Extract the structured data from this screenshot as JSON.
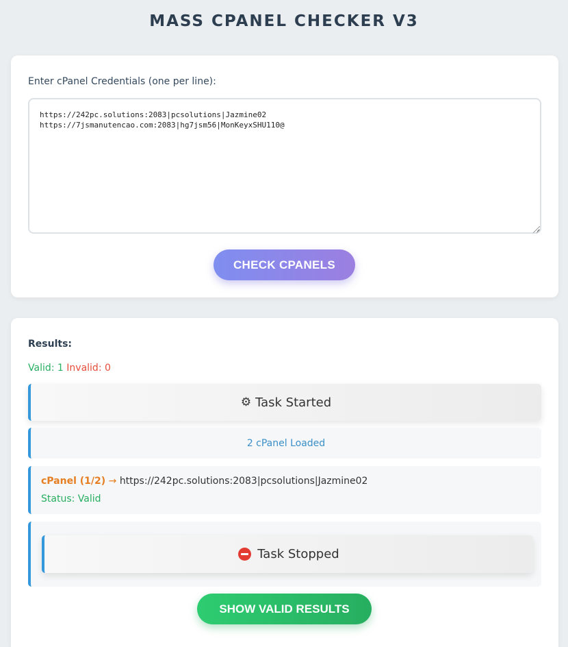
{
  "page": {
    "title": "MASS CPANEL CHECKER V3"
  },
  "input": {
    "label": "Enter cPanel Credentials (one per line):",
    "value": "https://242pc.solutions:2083|pcsolutions|Jazmine02\nhttps://7jsmanutencao.com:2083|hg7jsm56|MonKeyxSHU110@",
    "check_button": "CHECK CPANELS"
  },
  "results": {
    "label": "Results:",
    "valid_label": "Valid:",
    "valid_count": "1",
    "invalid_label": "Invalid:",
    "invalid_count": "0",
    "task_started": "Task Started",
    "loaded": "2 cPanel Loaded",
    "entry": {
      "tag": "cPanel (1/2)",
      "arrow": "→",
      "value": "https://242pc.solutions:2083|pcsolutions|Jazmine02",
      "status": "Status: Valid"
    },
    "task_stopped": "Task Stopped",
    "show_valid_button": "SHOW VALID RESULTS"
  },
  "icons": {
    "started": "gear-icon",
    "stopped": "no-entry-icon"
  },
  "colors": {
    "valid": "#27ae60",
    "invalid": "#e74c3c",
    "accent_border": "#3498db",
    "entry_tag": "#e67e22",
    "loaded_text": "#3a8fc9"
  }
}
